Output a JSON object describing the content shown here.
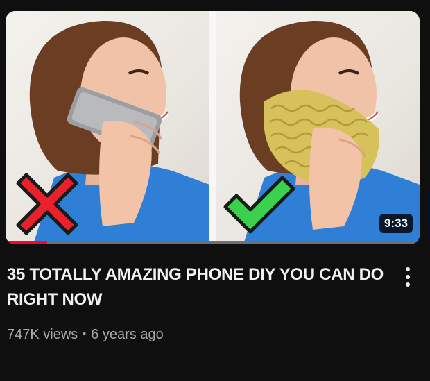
{
  "video": {
    "title": "35 TOTALLY AMAZING PHONE DIY YOU CAN DO RIGHT NOW",
    "views": "747K views",
    "separator": "•",
    "age": "6 years ago",
    "duration": "9:33",
    "watch_progress": 0.1
  },
  "thumbnail": {
    "left_mark_icon": "cross-icon",
    "right_mark_icon": "check-icon",
    "left_mark_color": "#e8212a",
    "right_mark_color": "#3ad14f"
  },
  "menu": {
    "icon": "vertical-ellipsis-icon"
  },
  "colors": {
    "background": "#0f0f0f",
    "progress": "#ff0033",
    "meta_text": "#aaaaaa"
  }
}
